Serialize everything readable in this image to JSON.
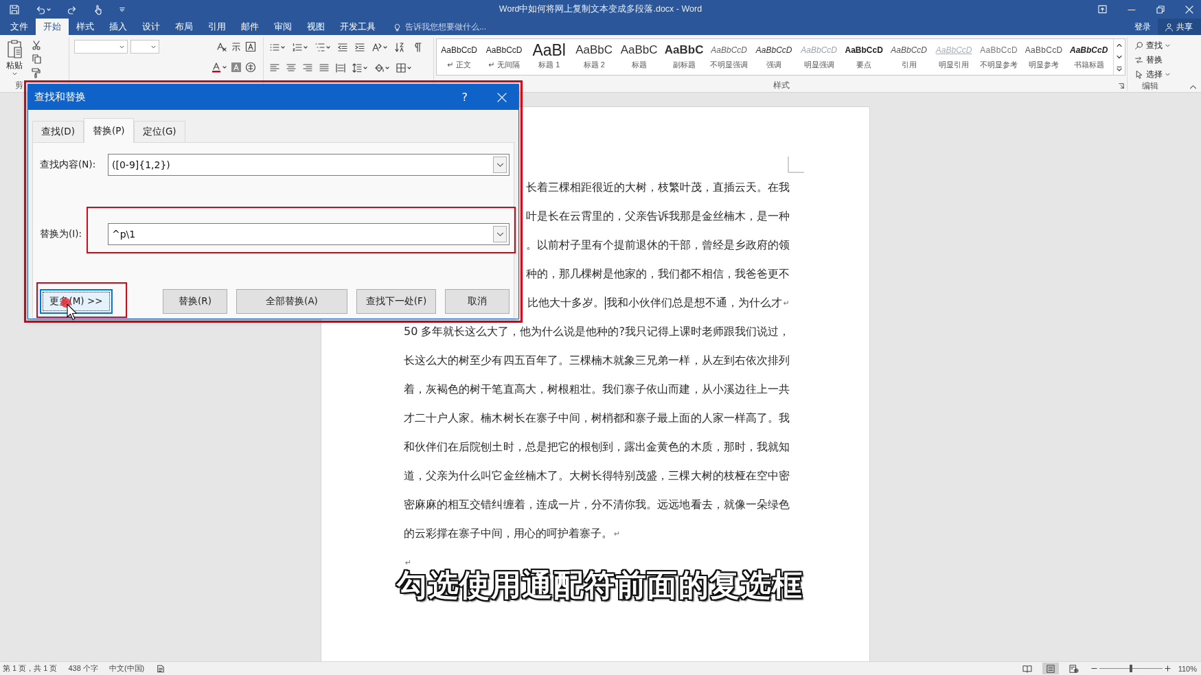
{
  "window": {
    "title": "Word中如何将网上复制文本变成多段落.docx - Word"
  },
  "ribbon_tabs": [
    {
      "label": "文件",
      "selected": false
    },
    {
      "label": "开始",
      "selected": true
    },
    {
      "label": "样式",
      "selected": false
    },
    {
      "label": "插入",
      "selected": false
    },
    {
      "label": "设计",
      "selected": false
    },
    {
      "label": "布局",
      "selected": false
    },
    {
      "label": "引用",
      "selected": false
    },
    {
      "label": "邮件",
      "selected": false
    },
    {
      "label": "审阅",
      "selected": false
    },
    {
      "label": "视图",
      "selected": false
    },
    {
      "label": "开发工具",
      "selected": false
    }
  ],
  "tell_me": {
    "placeholder": "告诉我您想要做什么..."
  },
  "account": {
    "sign_in": "登录",
    "share": "共享"
  },
  "ribbon": {
    "clipboard": {
      "paste": "粘贴",
      "group_label": "剪"
    },
    "styles": {
      "items": [
        {
          "preview": "AaBbCcD",
          "label": "↵ 正文",
          "kind": "normal"
        },
        {
          "preview": "AaBbCcD",
          "label": "↵ 无间隔",
          "kind": "normal"
        },
        {
          "preview": "AaBl",
          "label": "标题 1",
          "kind": "heading1"
        },
        {
          "preview": "AaBbC",
          "label": "标题 2",
          "kind": "heading2"
        },
        {
          "preview": "AaBbC",
          "label": "标题",
          "kind": "title"
        },
        {
          "preview": "AaBbC",
          "label": "副标题",
          "kind": "subtitle"
        },
        {
          "preview": "AaBbCcD",
          "label": "不明显强调",
          "kind": "subtle"
        },
        {
          "preview": "AaBbCcD",
          "label": "强调",
          "kind": "emphasis"
        },
        {
          "preview": "AaBbCcD",
          "label": "明显强调",
          "kind": "intense"
        },
        {
          "preview": "AaBbCcD",
          "label": "要点",
          "kind": "strong"
        },
        {
          "preview": "AaBbCcD",
          "label": "引用",
          "kind": "quote"
        },
        {
          "preview": "AaBbCcD",
          "label": "明显引用",
          "kind": "intense-quote"
        },
        {
          "preview": "AaBbCcD",
          "label": "不明显参考",
          "kind": "subtle-reference"
        },
        {
          "preview": "AaBbCcD",
          "label": "明显参考",
          "kind": "intense-reference"
        },
        {
          "preview": "AaBbCcD",
          "label": "书籍标题",
          "kind": "book-title"
        }
      ],
      "group_label": "样式"
    },
    "editing": {
      "find": "查找",
      "replace": "替换",
      "select": "选择",
      "group_label": "编辑"
    }
  },
  "dialog": {
    "title": "查找和替换",
    "help": "?",
    "highlighted": true,
    "tabs": [
      {
        "label": "查找(D)",
        "selected": false
      },
      {
        "label": "替换(P)",
        "selected": true
      },
      {
        "label": "定位(G)",
        "selected": false
      }
    ],
    "fields": [
      {
        "label": "查找内容(N):",
        "value": "([0-9]{1,2})",
        "highlighted": false
      },
      {
        "label": "替换为(I):",
        "value": "^p\\1",
        "highlighted": true
      }
    ],
    "buttons": [
      {
        "label": "更多(M) >>",
        "focused": true,
        "highlighted": true,
        "cursor": true
      },
      {
        "label": "替换(R)",
        "focused": false,
        "highlighted": false,
        "cursor": false
      },
      {
        "label": "全部替换(A)",
        "focused": false,
        "highlighted": false,
        "cursor": false
      },
      {
        "label": "查找下一处(F)",
        "focused": false,
        "highlighted": false,
        "cursor": false
      },
      {
        "label": "取消",
        "focused": false,
        "highlighted": false,
        "cursor": false
      }
    ]
  },
  "document": {
    "lines": [
      {
        "kind": "partial",
        "text": "长着三棵相距很近的大树，枝繁叶茂，直插云天。在我",
        "caret": false
      },
      {
        "kind": "partial",
        "text": "叶是长在云霄里的，父亲告诉我那是金丝楠木，是一种",
        "caret": false
      },
      {
        "kind": "partial",
        "text": "。以前村子里有个提前退休的干部，曾经是乡政府的领",
        "caret": false
      },
      {
        "kind": "partial",
        "text": "种的，那几棵树是他家的，我们都不相信，我爸爸更不",
        "caret": false
      },
      {
        "kind": "partial",
        "text": "比他大十多岁。",
        "caret": true,
        "after_caret": "我和小伙伴们总是想不通，为什么才",
        "mark": "↵"
      },
      {
        "kind": "full",
        "text": "50 多年就长这么大了，他为什么说是他种的?我只记得上课时老师跟我们说过，",
        "caret": false
      },
      {
        "kind": "full",
        "text": "长这么大的树至少有四五百年了。三棵楠木就象三兄弟一样，从左到右依次排列",
        "caret": false
      },
      {
        "kind": "full",
        "text": "着，灰褐色的树干笔直高大，树根粗壮。我们寨子依山而建，从小溪边往上一共",
        "caret": false
      },
      {
        "kind": "full",
        "text": "才二十户人家。楠木树长在寨子中间，树梢都和寨子最上面的人家一样高了。我",
        "caret": false
      },
      {
        "kind": "full",
        "text": "和伙伴们在后院刨土时，总是把它的根刨到，露出金黄色的木质，那时，我就知",
        "caret": false
      },
      {
        "kind": "full",
        "text": "道，父亲为什么叫它金丝楠木了。大树长得特别茂盛，三棵大树的枝桠在空中密",
        "caret": false
      },
      {
        "kind": "full",
        "text": "密麻麻的相互交错纠缠着，连成一片，分不清你我。远远地看去，就像一朵绿色",
        "caret": false
      },
      {
        "kind": "last",
        "text": "的云彩撑在寨子中间，用心的呵护着寨子。",
        "caret": false,
        "mark": "↵"
      }
    ],
    "empty_paragraph_mark": "↵"
  },
  "caption": "勾选使用通配符前面的复选框",
  "status_bar": {
    "page": "第 1 页，共 1 页",
    "word_count": "438 个字",
    "language": "中文(中国)",
    "views": [
      {
        "kind": "read",
        "selected": false
      },
      {
        "kind": "print",
        "selected": true
      },
      {
        "kind": "web",
        "selected": false
      }
    ],
    "zoom": {
      "level": 0.5,
      "reading": "110%"
    }
  }
}
